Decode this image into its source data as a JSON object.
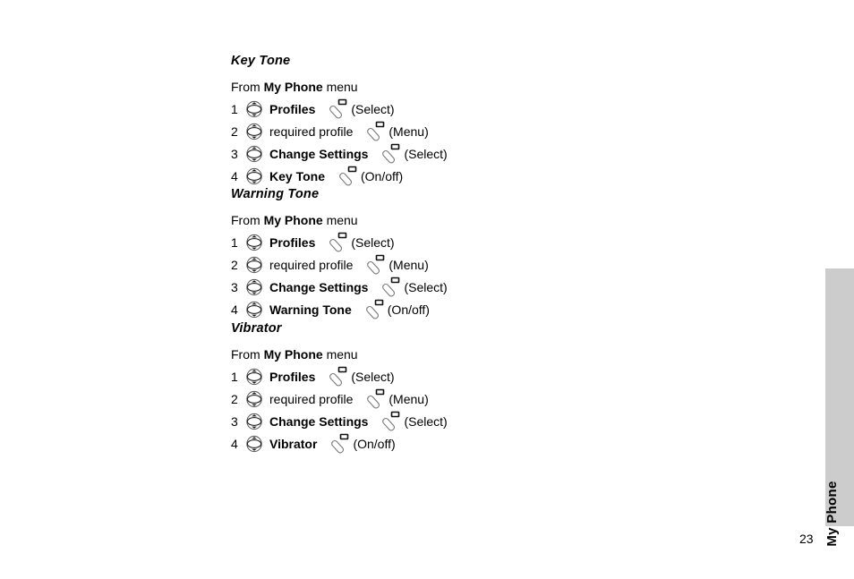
{
  "page": {
    "number": "23",
    "tab_label": "My Phone",
    "tab_color": "#cccccc"
  },
  "icons": {
    "nav_key": "navigation-scroll-key-icon",
    "soft_key": "soft-key-icon"
  },
  "sections": [
    {
      "heading": "Key Tone",
      "from_prefix": "From ",
      "from_bold": "My Phone",
      "from_suffix": " menu",
      "steps": [
        {
          "num": "1",
          "label": "Profiles",
          "bold": true,
          "action": "(Select)"
        },
        {
          "num": "2",
          "label": "required profile",
          "bold": false,
          "action": "(Menu)"
        },
        {
          "num": "3",
          "label": "Change Settings",
          "bold": true,
          "action": "(Select)"
        },
        {
          "num": "4",
          "label": "Key Tone",
          "bold": true,
          "action": "(On/off)"
        }
      ]
    },
    {
      "heading": "Warning Tone",
      "from_prefix": "From ",
      "from_bold": "My Phone",
      "from_suffix": " menu",
      "steps": [
        {
          "num": "1",
          "label": "Profiles",
          "bold": true,
          "action": "(Select)"
        },
        {
          "num": "2",
          "label": "required profile",
          "bold": false,
          "action": "(Menu)"
        },
        {
          "num": "3",
          "label": "Change Settings",
          "bold": true,
          "action": "(Select)"
        },
        {
          "num": "4",
          "label": "Warning Tone",
          "bold": true,
          "action": "(On/off)"
        }
      ]
    },
    {
      "heading": "Vibrator",
      "from_prefix": "From ",
      "from_bold": "My Phone",
      "from_suffix": " menu",
      "steps": [
        {
          "num": "1",
          "label": "Profiles",
          "bold": true,
          "action": "(Select)"
        },
        {
          "num": "2",
          "label": "required profile",
          "bold": false,
          "action": "(Menu)"
        },
        {
          "num": "3",
          "label": "Change Settings",
          "bold": true,
          "action": "(Select)"
        },
        {
          "num": "4",
          "label": "Vibrator",
          "bold": true,
          "action": "(On/off)"
        }
      ]
    }
  ]
}
